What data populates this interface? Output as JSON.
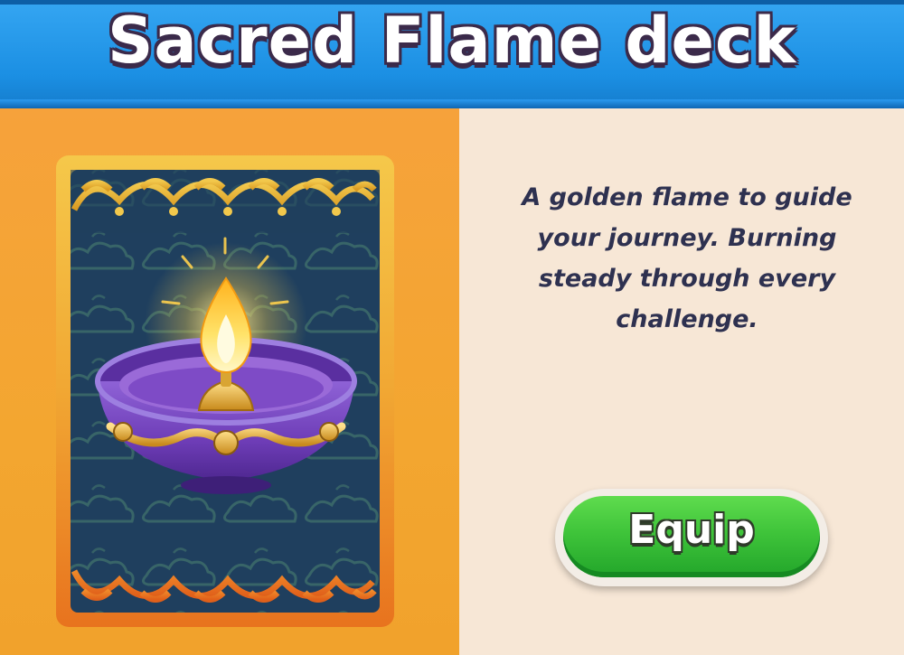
{
  "header": {
    "title": "Sacred Flame deck"
  },
  "deck": {
    "description": "A golden flame to guide your journey. Burning steady through every challenge.",
    "card_art_icon": "oil-lamp-diya-icon"
  },
  "actions": {
    "equip_label": "Equip"
  },
  "colors": {
    "header_blue": "#1b8fe3",
    "left_panel_orange": "#f3a630",
    "right_panel_cream": "#f7e7d6",
    "equip_green": "#3fc43a",
    "card_navy": "#1f3f5e",
    "card_gold": "#e7b73c",
    "lamp_purple": "#7a4bc2"
  }
}
